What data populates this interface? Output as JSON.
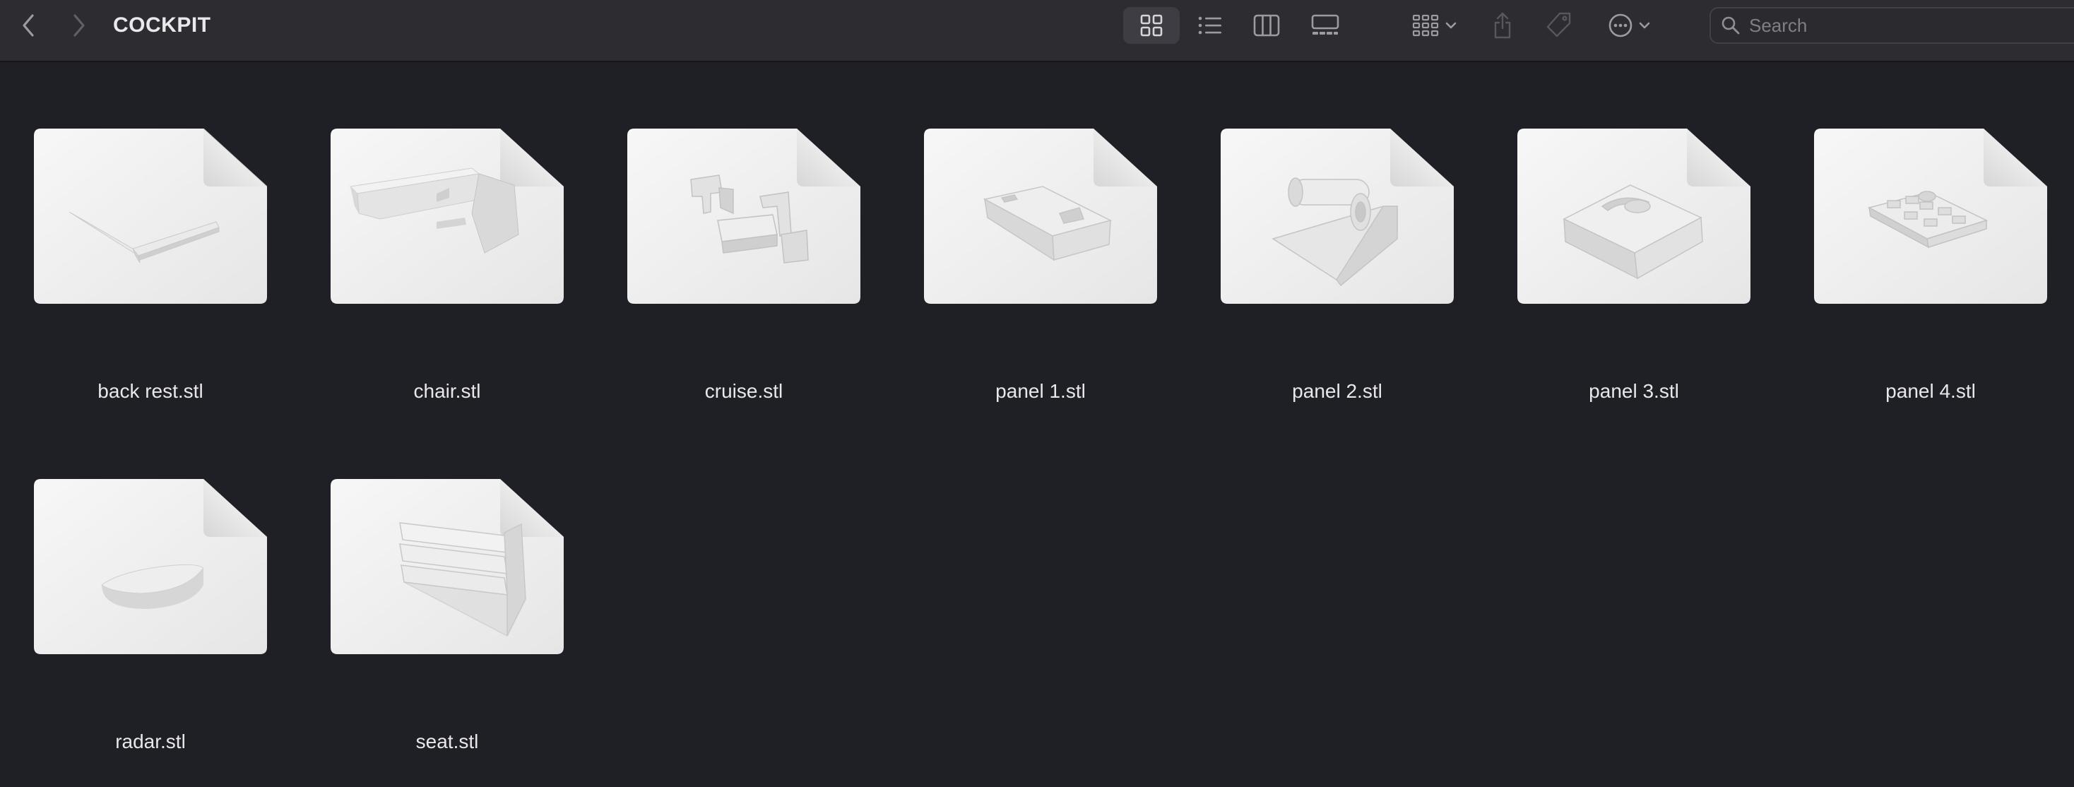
{
  "window": {
    "title": "COCKPIT"
  },
  "toolbar": {
    "back": "chevron-left-icon",
    "forward": "chevron-right-icon",
    "view_modes": [
      "icon-view",
      "list-view",
      "column-view",
      "gallery-view"
    ],
    "active_view": "icon-view",
    "search": {
      "placeholder": "Search",
      "value": ""
    }
  },
  "files": [
    {
      "name": "back rest.stl",
      "preview": "back-rest"
    },
    {
      "name": "chair.stl",
      "preview": "chair"
    },
    {
      "name": "cruise.stl",
      "preview": "cruise"
    },
    {
      "name": "panel 1.stl",
      "preview": "panel-1"
    },
    {
      "name": "panel 2.stl",
      "preview": "panel-2"
    },
    {
      "name": "panel 3.stl",
      "preview": "panel-3"
    },
    {
      "name": "panel 4.stl",
      "preview": "panel-4"
    },
    {
      "name": "radar.stl",
      "preview": "radar"
    },
    {
      "name": "seat.stl",
      "preview": "seat"
    }
  ],
  "colors": {
    "background": "#1f1f26",
    "toolbar": "#2c2c31",
    "text": "#e8e8ea"
  }
}
